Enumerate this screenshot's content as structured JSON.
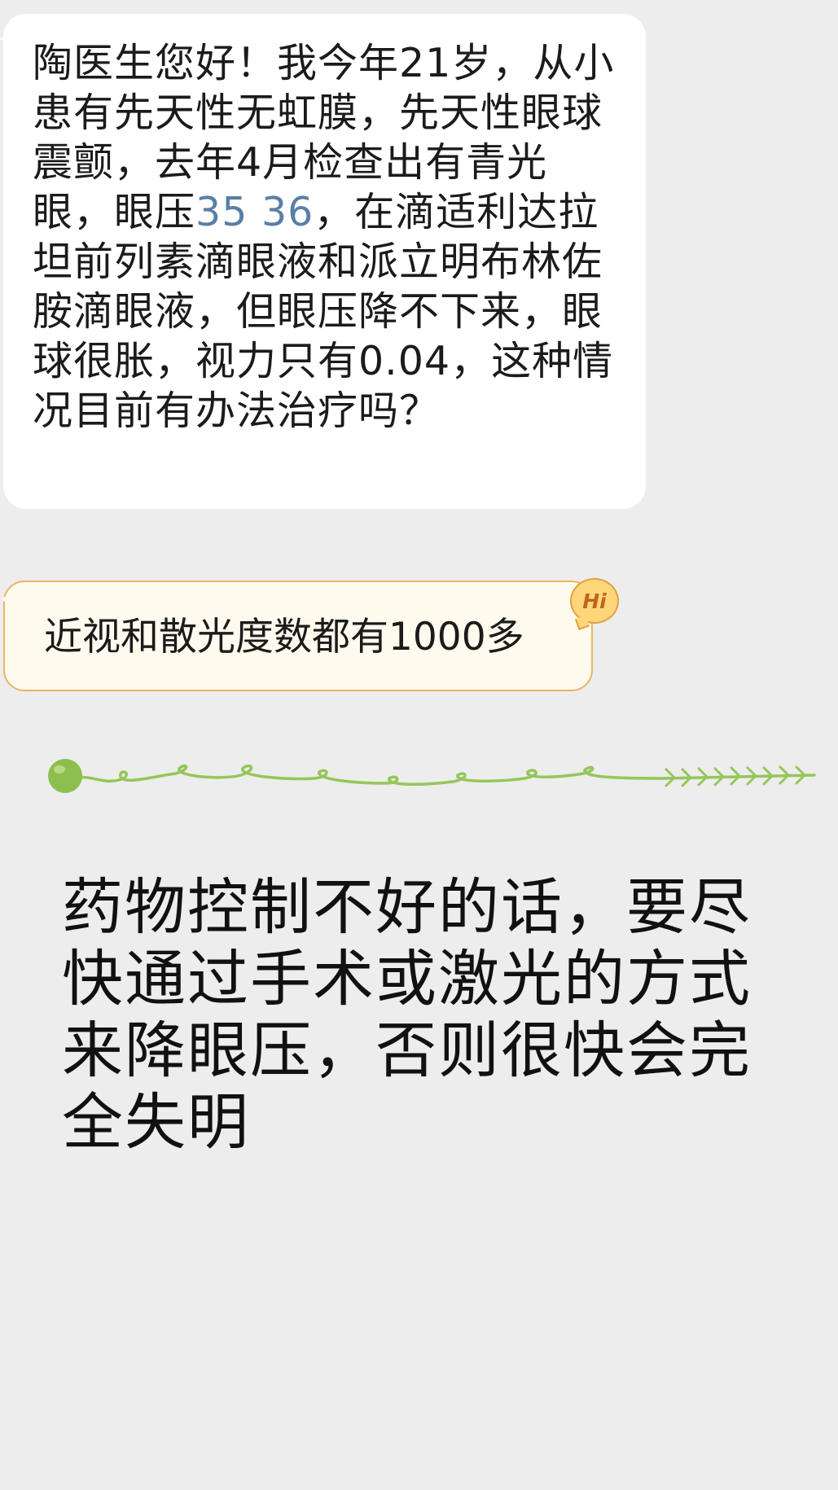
{
  "chat": {
    "question": {
      "before": "陶医生您好！我今年21岁，从小患有先天性无虹膜，先天性眼球震颤，去年4月检查出有青光眼，眼压",
      "link": "35 36",
      "after": "，在滴适利达拉坦前列素滴眼液和派立明布林佐胺滴眼液，但眼压降不下来，眼球很胀，视力只有0.04，这种情况目前有办法治疗吗？"
    },
    "note": {
      "text": "近视和散光度数都有1000多",
      "badge": "Hi"
    }
  },
  "answer": {
    "text": "药物控制不好的话，要尽快通过手术或激光的方式来降眼压，否则很快会完全失明"
  },
  "colors": {
    "background": "#ededed",
    "bubble": "#ffffff",
    "note_bubble": "#fffaee",
    "note_border": "#e9b461",
    "link": "#5a7fa6",
    "vine": "#95c65a"
  },
  "icons": {
    "badge": "hi-sticker-icon",
    "divider": "green-vine-divider-icon"
  }
}
